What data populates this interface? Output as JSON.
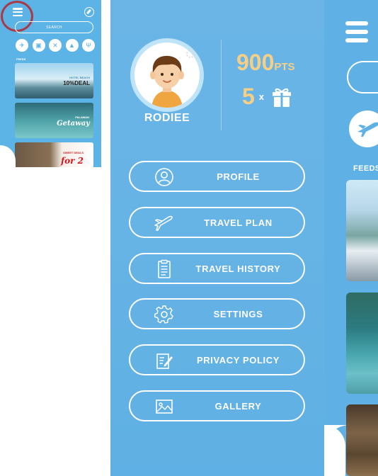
{
  "thumbnail": {
    "search_placeholder": "SEARCH",
    "feeds_label": "FEEDS",
    "cards": [
      {
        "line1": "HOTEL BEACH",
        "line2": "10%DEAL"
      },
      {
        "line1": "PALAWAN",
        "line2": "Getaway"
      },
      {
        "line1": "SWEET DEALS",
        "line2": "for 2"
      }
    ]
  },
  "profile": {
    "username": "RODIEE",
    "points_value": "900",
    "points_unit": "PTS",
    "gift_count": "5",
    "gift_multiplier": "x"
  },
  "menu": {
    "items": [
      {
        "label": "PROFILE",
        "icon": "user-icon"
      },
      {
        "label": "TRAVEL PLAN",
        "icon": "airplane-icon"
      },
      {
        "label": "TRAVEL HISTORY",
        "icon": "clipboard-icon"
      },
      {
        "label": "SETTINGS",
        "icon": "gear-icon"
      },
      {
        "label": "PRIVACY POLICY",
        "icon": "document-edit-icon"
      },
      {
        "label": "GALLERY",
        "icon": "image-icon"
      }
    ]
  },
  "right_panel": {
    "feeds_label": "FEEDS"
  },
  "colors": {
    "primary": "#62b2e5",
    "accent_gold": "#f6cf86",
    "highlight_red": "#b5262a"
  }
}
